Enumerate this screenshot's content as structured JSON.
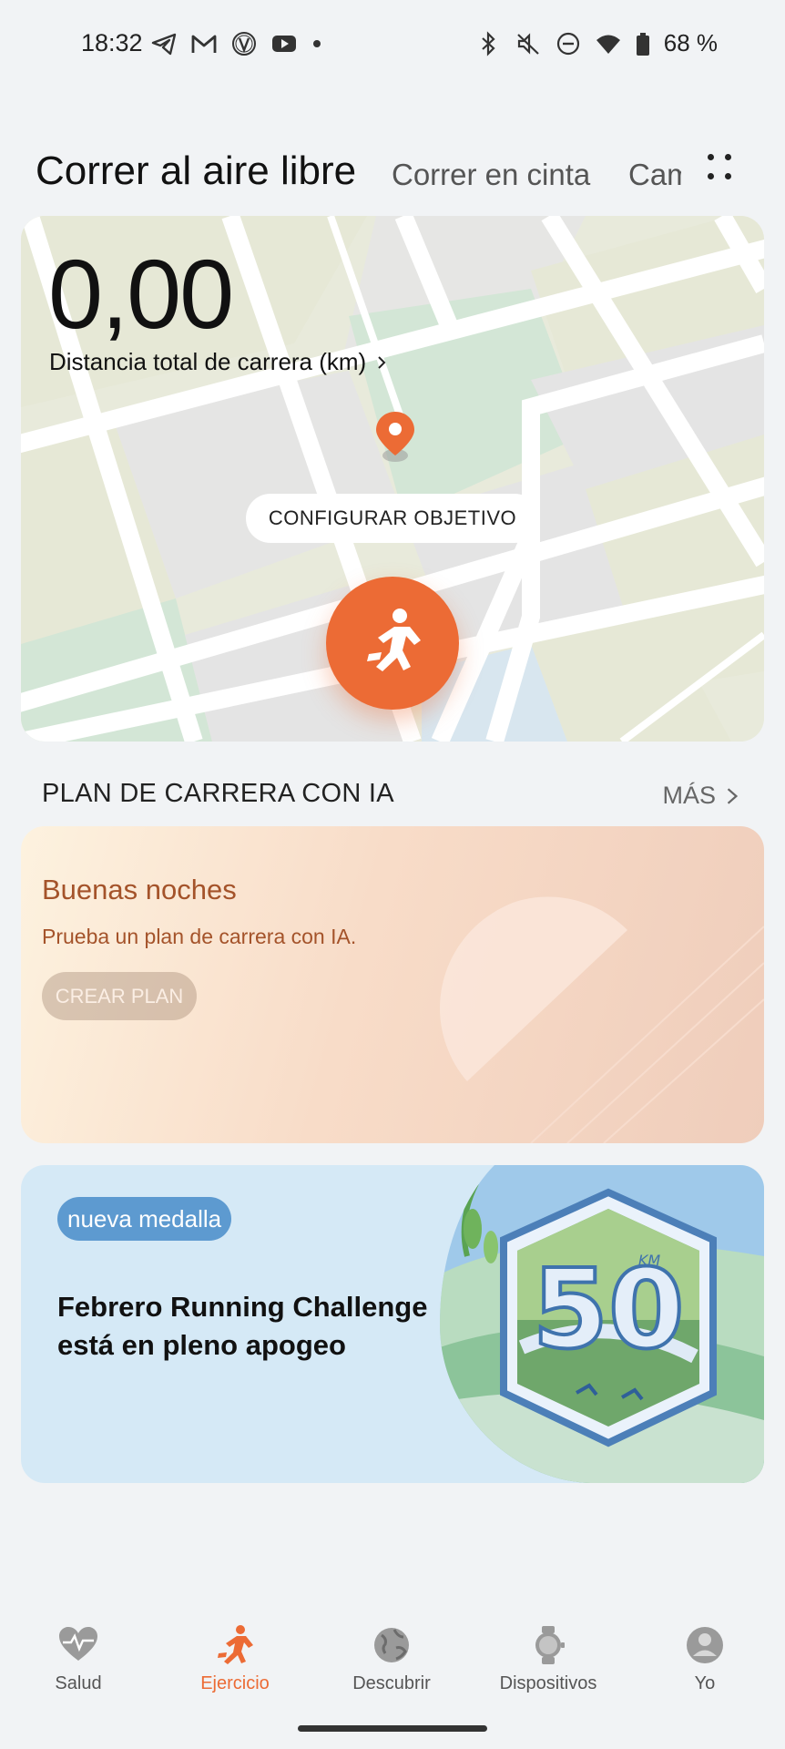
{
  "status_bar": {
    "time": "18:32",
    "battery": "68 %",
    "left_icons": [
      "telegram-icon",
      "gmail-icon",
      "vpn-icon",
      "youtube-icon",
      "dot-icon"
    ],
    "right_icons": [
      "bluetooth-icon",
      "mute-icon",
      "dnd-icon",
      "wifi-icon",
      "battery-icon"
    ]
  },
  "tabs": [
    {
      "label": "Correr al aire libre",
      "active": true
    },
    {
      "label": "Correr en cinta",
      "active": false
    },
    {
      "label": "Caminar",
      "active": false
    }
  ],
  "map_card": {
    "distance_value": "0,00",
    "distance_label": "Distancia total de carrera (km)",
    "goal_button": "CONFIGURAR OBJETIVO",
    "accent_color": "#ec6b35"
  },
  "ai_plan": {
    "section_title": "PLAN DE CARRERA CON IA",
    "more_label": "MÁS",
    "greeting": "Buenas noches",
    "subtitle": "Prueba un plan de carrera con IA.",
    "button": "CREAR PLAN"
  },
  "medal_card": {
    "badge": "nueva medalla",
    "title": "Febrero Running Challenge está en pleno apogeo",
    "medal_number": "50",
    "medal_unit": "KM"
  },
  "bottom_nav": [
    {
      "label": "Salud",
      "icon": "heart-pulse-icon",
      "active": false
    },
    {
      "label": "Ejercicio",
      "icon": "runner-icon",
      "active": true
    },
    {
      "label": "Descubrir",
      "icon": "globe-icon",
      "active": false
    },
    {
      "label": "Dispositivos",
      "icon": "watch-icon",
      "active": false
    },
    {
      "label": "Yo",
      "icon": "profile-icon",
      "active": false
    }
  ]
}
